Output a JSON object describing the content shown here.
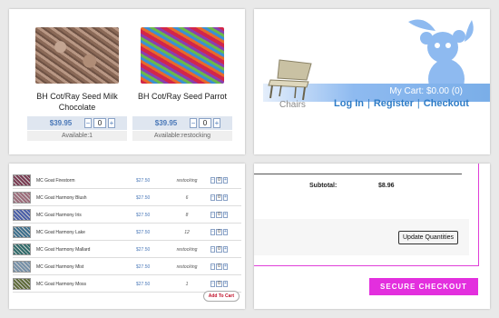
{
  "products": [
    {
      "name": "BH Cot/Ray Seed Milk Chocolate",
      "price": "$39.95",
      "qty": "0",
      "availability": "Available:1",
      "swatch_color": "#8a6957"
    },
    {
      "name": "BH Cot/Ray Seed Parrot",
      "price": "$39.95",
      "qty": "0",
      "availability": "Available:restocking",
      "swatch_color": "#d2264a"
    }
  ],
  "header": {
    "cart_text": "My Cart: $0.00 (0)",
    "category_label": "Chairs",
    "links": [
      "Log In",
      "Register",
      "Checkout"
    ],
    "brand_color": "#7aaee8"
  },
  "yarn_table": {
    "rows": [
      {
        "name": "MC Goat Firestorm",
        "price": "$27.50",
        "status": "restocking",
        "qty": "0",
        "color": "#7a3b52"
      },
      {
        "name": "MC Goat Harmony Blush",
        "price": "$27.50",
        "status": "6",
        "qty": "0",
        "color": "#9c6b7a"
      },
      {
        "name": "MC Goat Harmony Iris",
        "price": "$27.50",
        "status": "8",
        "qty": "0",
        "color": "#4a5fa8"
      },
      {
        "name": "MC Goat Harmony Lake",
        "price": "$27.50",
        "status": "12",
        "qty": "0",
        "color": "#3d6f8c"
      },
      {
        "name": "MC Goat Harmony Mallard",
        "price": "$27.50",
        "status": "restocking",
        "qty": "0",
        "color": "#2f6b6a"
      },
      {
        "name": "MC Goat Harmony Mist",
        "price": "$27.50",
        "status": "restocking",
        "qty": "0",
        "color": "#7590a8"
      },
      {
        "name": "MC Goat Harmony Moss",
        "price": "$27.50",
        "status": "1",
        "qty": "0",
        "color": "#5f6b3a"
      }
    ],
    "add_to_cart_label": "Add To Cart"
  },
  "checkout": {
    "subtotal_label": "Subtotal:",
    "subtotal_value": "$8.96",
    "update_label": "Update Quantities",
    "secure_label": "SECURE CHECKOUT",
    "accent_color": "#e32fde"
  }
}
